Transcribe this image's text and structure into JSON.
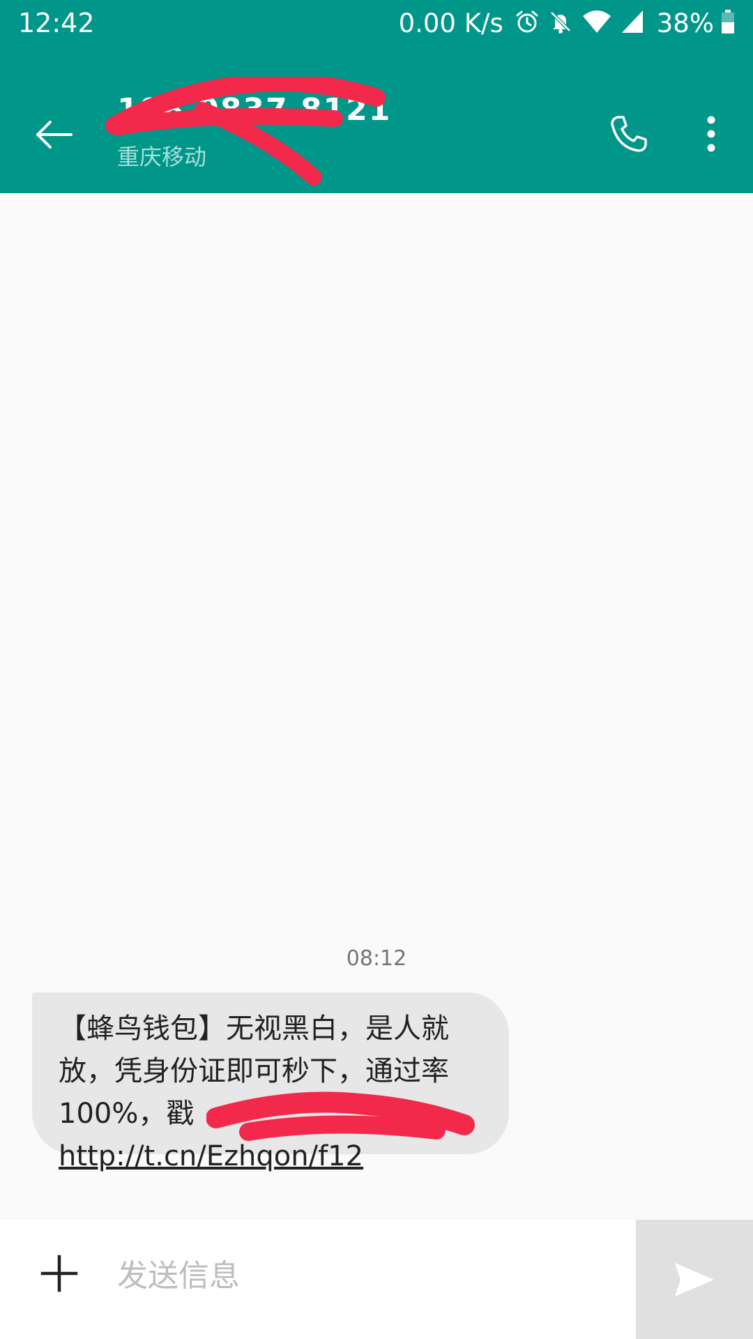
{
  "status_bar": {
    "time": "12:42",
    "net_speed": "0.00 K/s",
    "battery": "38%",
    "icons": [
      "alarm-icon",
      "bell-off-icon",
      "wifi-icon",
      "cell-signal-icon",
      "battery-icon"
    ]
  },
  "header": {
    "contact_number": "198 0837 8121",
    "contact_carrier": "重庆移动",
    "icons": [
      "back-arrow-icon",
      "phone-icon",
      "more-vert-icon"
    ]
  },
  "conversation": {
    "timestamp": "08:12",
    "message": {
      "text": "【蜂鸟钱包】无视黑白，是人就放，凭身份证即可秒下，通过率100%，戳 ",
      "link": "http://t.cn/Ezhqon/f12"
    }
  },
  "composer": {
    "placeholder": "发送信息",
    "icons": [
      "plus-icon",
      "send-icon"
    ]
  },
  "colors": {
    "app_bar": "#00968a",
    "bubble_bg": "#e7e7e7",
    "redaction": "#f2294a",
    "send_bg": "#e0e0e0"
  }
}
